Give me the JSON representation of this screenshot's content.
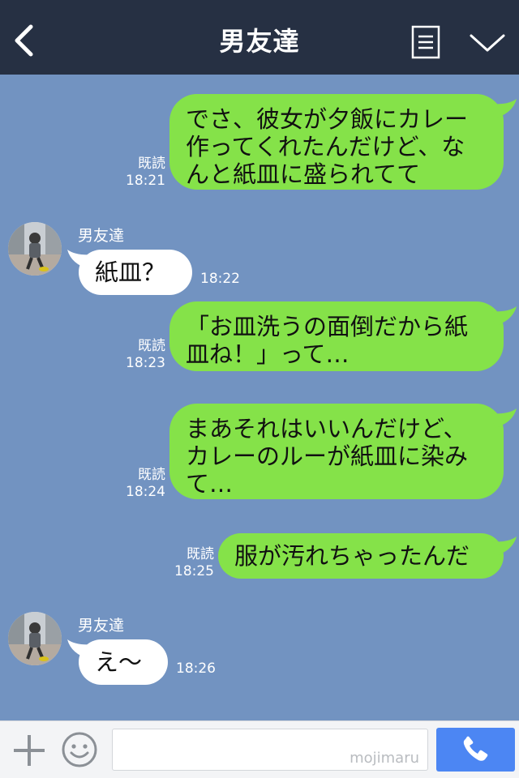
{
  "header": {
    "title": "男友達",
    "back_icon": "chevron-left-icon",
    "menu_icon": "list-icon",
    "collapse_icon": "chevron-down-icon"
  },
  "messages": [
    {
      "side": "sent",
      "text": "でさ、彼女が夕飯にカレー作ってくれたんだけど、なんと紙皿に盛られてて",
      "read": "既読",
      "time": "18:21"
    },
    {
      "side": "received",
      "sender": "男友達",
      "text": "紙皿？",
      "time": "18:22"
    },
    {
      "side": "sent",
      "text": "「お皿洗うの面倒だから紙皿ね！」って…",
      "read": "既読",
      "time": "18:23"
    },
    {
      "side": "sent",
      "text": "まあそれはいいんだけど、カレーのルーが紙皿に染みて…",
      "read": "既読",
      "time": "18:24"
    },
    {
      "side": "sent",
      "text": "服が汚れちゃったんだ",
      "read": "既読",
      "time": "18:25"
    },
    {
      "side": "received",
      "sender": "男友達",
      "text": "え〜",
      "time": "18:26"
    }
  ],
  "input": {
    "placeholder": "",
    "watermark": "mojimaru"
  },
  "colors": {
    "header_bg": "#263043",
    "chat_bg": "#7293c1",
    "sent_bubble": "#85e249",
    "received_bubble": "#ffffff",
    "call_button": "#4c86f3"
  }
}
